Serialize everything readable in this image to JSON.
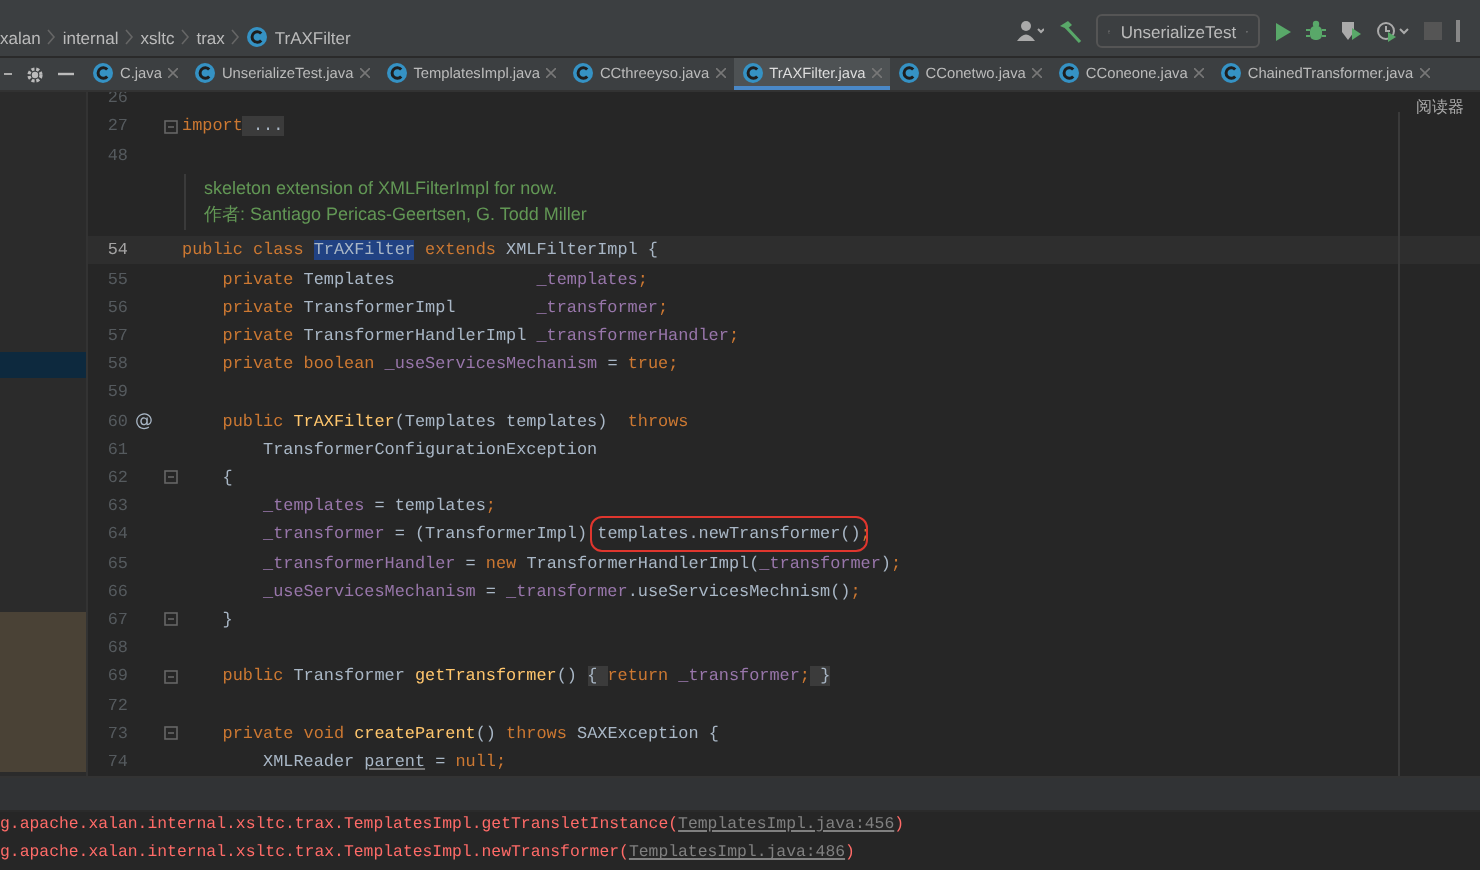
{
  "breadcrumbs": [
    {
      "label": "xalan",
      "kind": "package"
    },
    {
      "label": "internal",
      "kind": "package"
    },
    {
      "label": "xsltc",
      "kind": "package"
    },
    {
      "label": "trax",
      "kind": "package"
    },
    {
      "label": "TrAXFilter",
      "kind": "class"
    }
  ],
  "toolbar": {
    "run_config": "UnserializeTest"
  },
  "tabs": [
    {
      "label": "C.java",
      "selected": false
    },
    {
      "label": "UnserializeTest.java",
      "selected": false
    },
    {
      "label": "TemplatesImpl.java",
      "selected": false
    },
    {
      "label": "CCthreeyso.java",
      "selected": false
    },
    {
      "label": "TrAXFilter.java",
      "selected": true
    },
    {
      "label": "CConetwo.java",
      "selected": false
    },
    {
      "label": "CConeone.java",
      "selected": false
    },
    {
      "label": "ChainedTransformer.java",
      "selected": false
    }
  ],
  "editor": {
    "reader_mode_label": "阅读器",
    "lines": [
      {
        "kind": "code",
        "number": "26",
        "current": false,
        "fold": false
      },
      {
        "kind": "code",
        "number": "27",
        "current": false,
        "fold": true,
        "tokens": [
          {
            "t": "import",
            "kind": "kw"
          },
          {
            "t": " ...",
            "kind": "fold"
          }
        ]
      },
      {
        "kind": "code",
        "number": "48",
        "current": false,
        "fold": false
      },
      {
        "kind": "doc",
        "text": "skeleton extension of XMLFilterImpl for now."
      },
      {
        "kind": "doc",
        "text": "作者: Santiago Pericas-Geertsen, G. Todd Miller"
      },
      {
        "kind": "code",
        "number": "54",
        "current": true,
        "fold": false,
        "tokens": [
          {
            "t": "public class ",
            "kind": "kw"
          },
          {
            "t": "TrAXFilter",
            "kind": "sel"
          },
          {
            "t": " extends ",
            "kind": "kw"
          },
          {
            "t": "XMLFilterImpl {",
            "kind": "plain"
          }
        ]
      },
      {
        "kind": "code",
        "number": "55",
        "current": false,
        "fold": false,
        "tokens": [
          {
            "t": "    private ",
            "kind": "kw"
          },
          {
            "t": "Templates              ",
            "kind": "plain"
          },
          {
            "t": "_templates",
            "kind": "field"
          },
          {
            "t": ";",
            "kind": "kw"
          }
        ]
      },
      {
        "kind": "code",
        "number": "56",
        "current": false,
        "fold": false,
        "tokens": [
          {
            "t": "    private ",
            "kind": "kw"
          },
          {
            "t": "TransformerImpl        ",
            "kind": "plain"
          },
          {
            "t": "_transformer",
            "kind": "field"
          },
          {
            "t": ";",
            "kind": "kw"
          }
        ]
      },
      {
        "kind": "code",
        "number": "57",
        "current": false,
        "fold": false,
        "tokens": [
          {
            "t": "    private ",
            "kind": "kw"
          },
          {
            "t": "TransformerHandlerImpl ",
            "kind": "plain"
          },
          {
            "t": "_transformerHandler",
            "kind": "field"
          },
          {
            "t": ";",
            "kind": "kw"
          }
        ]
      },
      {
        "kind": "code",
        "number": "58",
        "current": false,
        "fold": false,
        "tokens": [
          {
            "t": "    private boolean ",
            "kind": "kw"
          },
          {
            "t": "_useServicesMechanism",
            "kind": "field"
          },
          {
            "t": " = ",
            "kind": "plain"
          },
          {
            "t": "true;",
            "kind": "kw"
          }
        ]
      },
      {
        "kind": "code",
        "number": "59",
        "current": false,
        "fold": false
      },
      {
        "kind": "code",
        "number": "60",
        "current": false,
        "fold": false,
        "gutter_mark": "@",
        "tokens": [
          {
            "t": "    public ",
            "kind": "kw"
          },
          {
            "t": "TrAXFilter",
            "kind": "method"
          },
          {
            "t": "(Templates templates)  ",
            "kind": "plain"
          },
          {
            "t": "throws",
            "kind": "kw"
          }
        ]
      },
      {
        "kind": "code",
        "number": "61",
        "current": false,
        "fold": false,
        "tokens": [
          {
            "t": "        TransformerConfigurationException",
            "kind": "plain"
          }
        ]
      },
      {
        "kind": "code",
        "number": "62",
        "current": false,
        "fold": true,
        "tokens": [
          {
            "t": "    {",
            "kind": "plain"
          }
        ]
      },
      {
        "kind": "code",
        "number": "63",
        "current": false,
        "fold": false,
        "tokens": [
          {
            "t": "        _templates",
            "kind": "field"
          },
          {
            "t": " = templates",
            "kind": "plain"
          },
          {
            "t": ";",
            "kind": "kw"
          }
        ]
      },
      {
        "kind": "code",
        "number": "64",
        "current": false,
        "fold": false,
        "tokens": [
          {
            "t": "        _transformer",
            "kind": "field"
          },
          {
            "t": " = (TransformerImpl) ",
            "kind": "plain"
          },
          {
            "t": "templates.newTransformer()",
            "kind": "boxed"
          },
          {
            "t": ";",
            "kind": "kw"
          }
        ]
      },
      {
        "kind": "code",
        "number": "65",
        "current": false,
        "fold": false,
        "tokens": [
          {
            "t": "        _transformerHandler",
            "kind": "field"
          },
          {
            "t": " = ",
            "kind": "plain"
          },
          {
            "t": "new ",
            "kind": "kw"
          },
          {
            "t": "TransformerHandlerImpl(",
            "kind": "plain"
          },
          {
            "t": "_transformer",
            "kind": "field"
          },
          {
            "t": ")",
            "kind": "plain"
          },
          {
            "t": ";",
            "kind": "kw"
          }
        ]
      },
      {
        "kind": "code",
        "number": "66",
        "current": false,
        "fold": false,
        "tokens": [
          {
            "t": "        _useServicesMechanism",
            "kind": "field"
          },
          {
            "t": " = ",
            "kind": "plain"
          },
          {
            "t": "_transformer",
            "kind": "field"
          },
          {
            "t": ".useServicesMechnism()",
            "kind": "plain"
          },
          {
            "t": ";",
            "kind": "kw"
          }
        ]
      },
      {
        "kind": "code",
        "number": "67",
        "current": false,
        "fold": true,
        "tokens": [
          {
            "t": "    }",
            "kind": "plain"
          }
        ]
      },
      {
        "kind": "code",
        "number": "68",
        "current": false,
        "fold": false
      },
      {
        "kind": "code",
        "number": "69",
        "current": false,
        "fold": true,
        "tokens": [
          {
            "t": "    public ",
            "kind": "kw"
          },
          {
            "t": "Transformer ",
            "kind": "plain"
          },
          {
            "t": "getTransformer",
            "kind": "method"
          },
          {
            "t": "() ",
            "kind": "plain"
          },
          {
            "t": "{ ",
            "kind": "fold"
          },
          {
            "t": "return ",
            "kind": "kw"
          },
          {
            "t": "_transformer",
            "kind": "field"
          },
          {
            "t": ";",
            "kind": "kw"
          },
          {
            "t": " }",
            "kind": "fold"
          }
        ]
      },
      {
        "kind": "code",
        "number": "72",
        "current": false,
        "fold": false
      },
      {
        "kind": "code",
        "number": "73",
        "current": false,
        "fold": true,
        "tokens": [
          {
            "t": "    private void ",
            "kind": "kw"
          },
          {
            "t": "createParent",
            "kind": "method"
          },
          {
            "t": "() ",
            "kind": "plain"
          },
          {
            "t": "throws ",
            "kind": "kw"
          },
          {
            "t": "SAXException {",
            "kind": "plain"
          }
        ]
      },
      {
        "kind": "code",
        "number": "74",
        "current": false,
        "fold": false,
        "tokens": [
          {
            "t": "        XMLReader ",
            "kind": "plain"
          },
          {
            "t": "parent",
            "kind": "local"
          },
          {
            "t": " = ",
            "kind": "plain"
          },
          {
            "t": "null;",
            "kind": "kw"
          }
        ]
      }
    ]
  },
  "console": [
    {
      "text": "g.apache.xalan.internal.xsltc.trax.TemplatesImpl.getTransletInstance(",
      "link": "TemplatesImpl.java:456",
      "tail": ")"
    },
    {
      "text": "g.apache.xalan.internal.xsltc.trax.TemplatesImpl.newTransformer(",
      "link": "TemplatesImpl.java:486",
      "tail": ")"
    }
  ]
}
